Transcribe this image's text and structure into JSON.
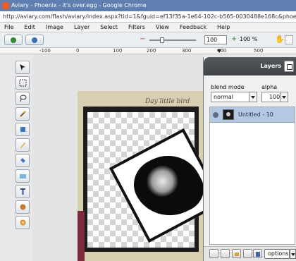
{
  "window": {
    "title": "Aviary - Phoenix - it's over.egg - Google Chrome",
    "url": "http://aviary.com/flash/aviary/index.aspx?tid=1&fguid=ef13f35a-1e64-102c-b565-0030488e168c&phoenix"
  },
  "menu": [
    "File",
    "Edit",
    "Image",
    "Layer",
    "Select",
    "Filters",
    "View",
    "Feedback",
    "Help"
  ],
  "toolbar": {
    "zoom_value": "100",
    "zoom_label": "100 %",
    "zoom_slider_fraction": 0.25,
    "icons": [
      "redo-icon",
      "history-icon",
      "zoom-out-icon",
      "zoom-in-icon",
      "hand-icon"
    ]
  },
  "ruler": {
    "labels": [
      "-100",
      "0",
      "100",
      "200",
      "300",
      "400",
      "500"
    ]
  },
  "tools": [
    "move-tool-icon",
    "marquee-tool-icon",
    "lasso-tool-icon",
    "magic-wand-icon",
    "crop-tool-icon",
    "pencil-tool-icon",
    "fill-bucket-icon",
    "gradient-tool-icon",
    "text-tool-icon",
    "color-picker-icon",
    "smudge-tool-icon"
  ],
  "canvas": {
    "frame_text": "Day little bird"
  },
  "layers": {
    "title": "Layers",
    "blend_mode_label": "blend mode",
    "alpha_label": "alpha",
    "blend_mode_value": "normal",
    "alpha_value": "100",
    "items": [
      {
        "name": "Untitled - 10",
        "visible": true
      }
    ],
    "options_label": "options"
  },
  "colors": {
    "titlebar": "#5f7fb0",
    "panel_header": "#474b50",
    "layer_selected": "#b4c8e2"
  }
}
